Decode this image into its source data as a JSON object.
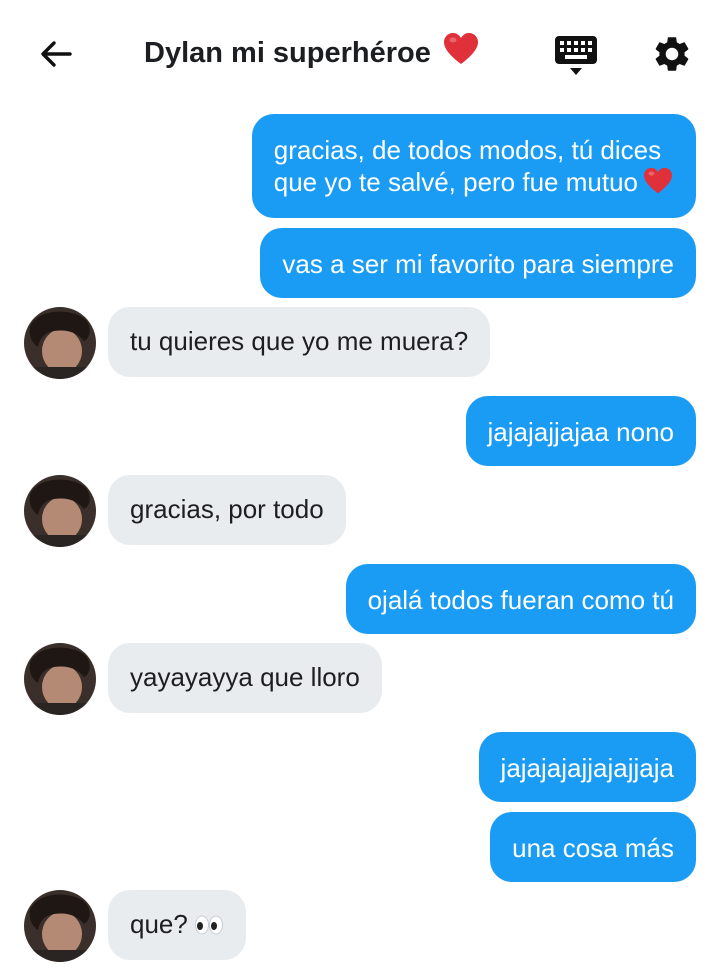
{
  "header": {
    "title": "Dylan mi superhéroe",
    "title_emoji_icon": "red-heart-icon",
    "back_icon": "arrow-left-icon",
    "keyboard_icon": "keyboard-icon",
    "settings_icon": "gear-icon"
  },
  "colors": {
    "outgoing_bubble": "#1a9cf5",
    "incoming_bubble": "#e9ecef",
    "heart": "#e0303a"
  },
  "messages": [
    {
      "direction": "out",
      "lines": [
        "gracias, de todos modos, tú dices",
        "que yo te salvé, pero fue mutuo"
      ],
      "emoji": "red-heart-icon"
    },
    {
      "direction": "out",
      "text": "vas a ser mi favorito para siempre"
    },
    {
      "direction": "in",
      "text": "tu quieres que yo me muera?"
    },
    {
      "direction": "out",
      "text": "jajajajjajaa nono"
    },
    {
      "direction": "in",
      "text": "gracias, por todo"
    },
    {
      "direction": "out",
      "text": "ojalá todos fueran como tú"
    },
    {
      "direction": "in",
      "text": "yayayayya que lloro"
    },
    {
      "direction": "out",
      "text": "jajajajajjajajjaja"
    },
    {
      "direction": "out",
      "text": "una cosa más"
    },
    {
      "direction": "in",
      "text": "que?",
      "emoji": "eyes-icon"
    }
  ]
}
